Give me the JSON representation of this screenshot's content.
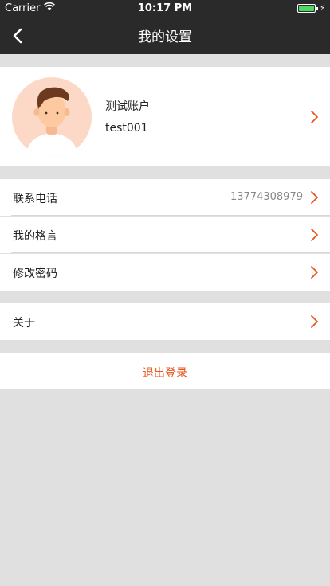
{
  "status_bar": {
    "carrier": "Carrier",
    "time": "10:17 PM",
    "wifi_icon": "wifi-icon",
    "battery_icon": "battery-icon",
    "battery_level": 1.0
  },
  "nav": {
    "title": "我的设置",
    "back_icon": "chevron-left-icon"
  },
  "profile": {
    "name": "测试账户",
    "id": "test001",
    "avatar_icon": "avatar"
  },
  "settings": {
    "phone": {
      "label": "联系电话",
      "value": "13774308979"
    },
    "motto": {
      "label": "我的格言"
    },
    "password": {
      "label": "修改密码"
    },
    "about": {
      "label": "关于"
    }
  },
  "logout": {
    "label": "退出登录"
  },
  "colors": {
    "accent": "#e8541c",
    "bar": "#2a2a2a",
    "background": "#e0e0e0",
    "battery": "#4cd964"
  }
}
